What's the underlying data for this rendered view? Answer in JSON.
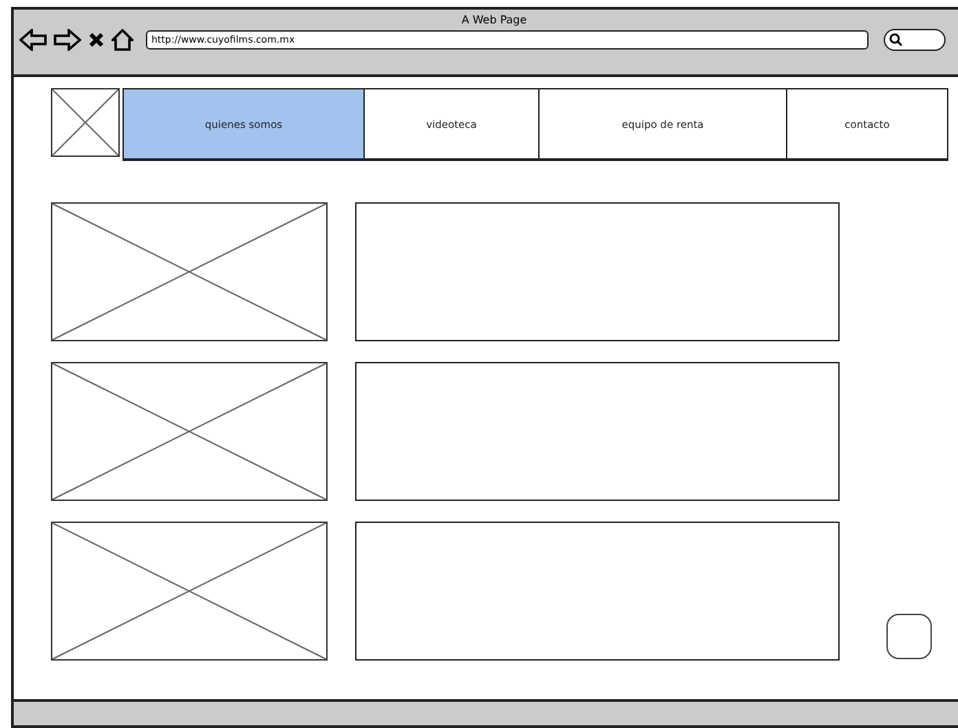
{
  "window": {
    "title": "A Web Page",
    "url": "http://www.cuyofilms.com.mx"
  },
  "nav": {
    "tabs": [
      {
        "label": "quienes somos",
        "selected": true
      },
      {
        "label": "videoteca",
        "selected": false
      },
      {
        "label": "equipo de renta",
        "selected": false
      },
      {
        "label": "contacto",
        "selected": false
      }
    ]
  }
}
